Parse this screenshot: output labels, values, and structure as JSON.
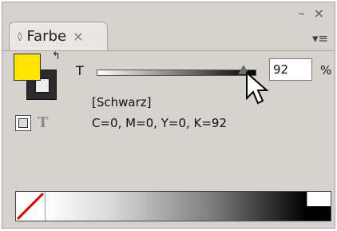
{
  "window": {
    "minimize": "–",
    "close": "×"
  },
  "tab": {
    "title": "Farbe",
    "close": "×",
    "options_icon": "◊"
  },
  "menu": {
    "icon": "▾≡"
  },
  "tint": {
    "label": "T",
    "value": "92",
    "unit": "%",
    "level_fraction": 0.92
  },
  "swatch": {
    "name": "[Schwarz]",
    "cmyk": "C=0, M=0, Y=0, K=92"
  },
  "colors": {
    "fill": "#ffe400",
    "stroke": "#2b2b2b",
    "panel": "#d6d3ce"
  },
  "icons": {
    "fill": "fill-swatch-icon",
    "stroke": "stroke-swatch-icon",
    "swap": "swap-arrow-icon",
    "container": "formatting-container-icon",
    "text": "formatting-text-icon",
    "none": "none-swatch-icon",
    "cursor": "arrow-cursor-icon"
  }
}
